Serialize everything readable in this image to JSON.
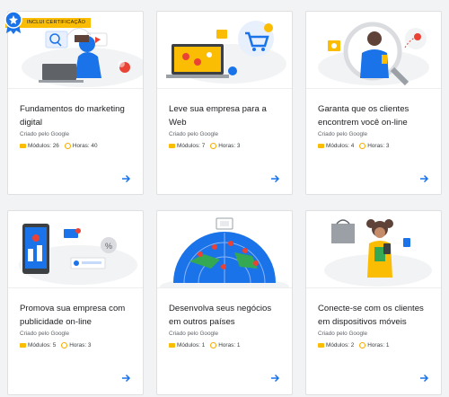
{
  "badge": {
    "label": "INCLUI CERTIFICAÇÃO"
  },
  "colors": {
    "accent": "#1a73e8",
    "hours": "#f9ab00",
    "modules": "#fbbc04"
  },
  "courses": [
    {
      "title": "Fundamentos do marketing digital",
      "byline": "Criado pelo Google",
      "modules": "Módulos: 26",
      "hours": "Horas: 40"
    },
    {
      "title": "Leve sua empresa para a Web",
      "byline": "Criado pelo Google",
      "modules": "Módulos: 7",
      "hours": "Horas: 3"
    },
    {
      "title": "Garanta que os clientes encontrem você on-line",
      "byline": "Criado pelo Google",
      "modules": "Módulos: 4",
      "hours": "Horas: 3"
    },
    {
      "title": "Promova sua empresa com publicidade on-line",
      "byline": "Criado pelo Google",
      "modules": "Módulos: 5",
      "hours": "Horas: 3"
    },
    {
      "title": "Desenvolva seus negócios em outros países",
      "byline": "Criado pelo Google",
      "modules": "Módulos: 1",
      "hours": "Horas: 1"
    },
    {
      "title": "Conecte-se com os clientes em dispositivos móveis",
      "byline": "Criado pelo Google",
      "modules": "Módulos: 2",
      "hours": "Horas: 1"
    }
  ]
}
